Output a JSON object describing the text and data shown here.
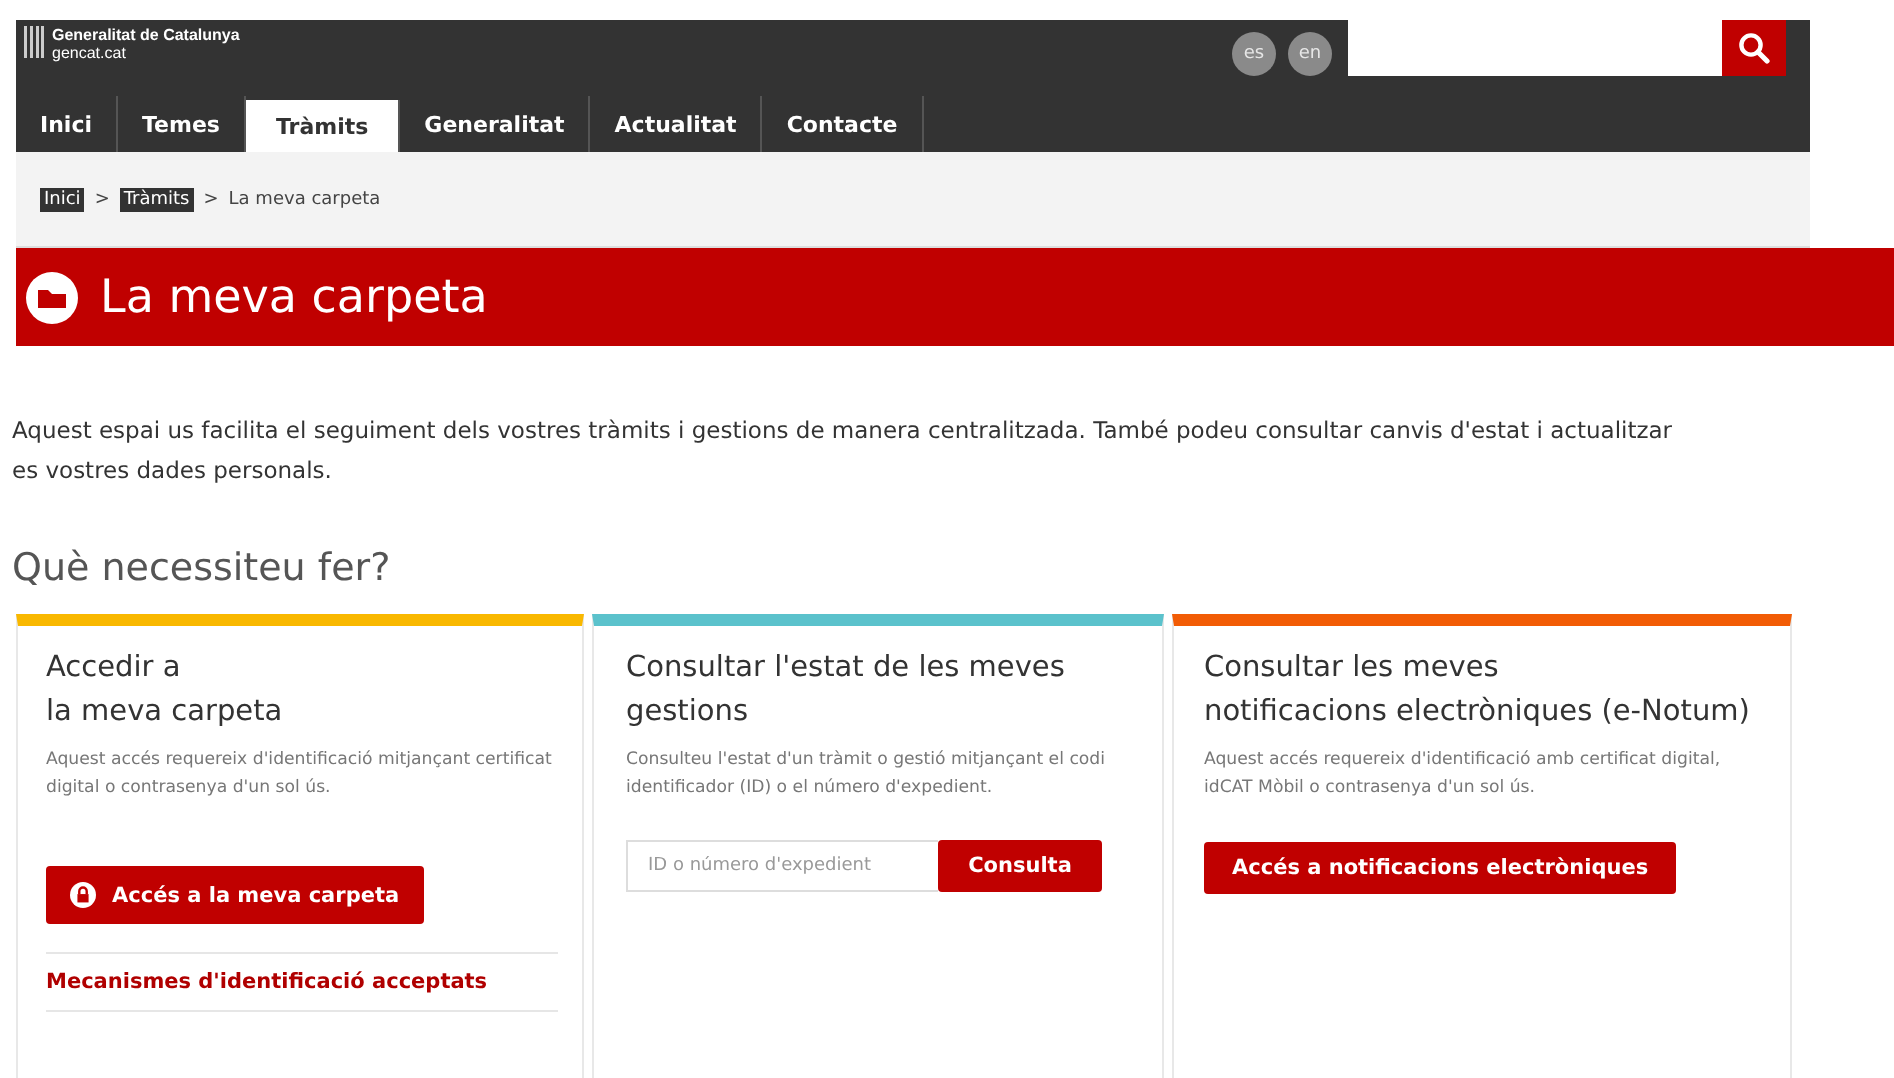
{
  "brand": {
    "title": "Generalitat de Catalunya",
    "subtitle": "gencat.cat"
  },
  "languages": [
    "es",
    "en"
  ],
  "nav": [
    {
      "label": "Inici",
      "selected": false
    },
    {
      "label": "Temes",
      "selected": false
    },
    {
      "label": "Tràmits",
      "selected": true
    },
    {
      "label": "Generalitat",
      "selected": false
    },
    {
      "label": "Actualitat",
      "selected": false
    },
    {
      "label": "Contacte",
      "selected": false
    }
  ],
  "breadcrumb": {
    "links": [
      "Inici",
      "Tràmits"
    ],
    "current": "La meva carpeta",
    "separator": ">"
  },
  "banner": {
    "title": "La meva carpeta"
  },
  "intro": [
    "Aquest espai us facilita el seguiment dels vostres tràmits i gestions de manera centralitzada. També podeu consultar canvis d'estat i actualitzar",
    "es vostres dades personals."
  ],
  "section_title": "Què necessiteu fer?",
  "cards": [
    {
      "color": "#f9b800",
      "title": [
        "Accedir a",
        "la meva carpeta"
      ],
      "description": "Aquest accés requereix d'identificació mitjançant certificat digital o contrasenya d'un sol ús.",
      "kind": "button",
      "button": {
        "label": "Accés a la meva carpeta",
        "icon": true
      },
      "link": "Mecanismes d'identificació acceptats"
    },
    {
      "color": "#5bc2cc",
      "title": [
        "Consultar l'estat de les meves",
        "gestions"
      ],
      "description": "Consulteu l'estat d'un tràmit o gestió mitjançant el codi identificador (ID) o el número d'expedient.",
      "kind": "search",
      "field": {
        "placeholder": "ID o número d'expedient"
      },
      "button": {
        "label": "Consulta"
      }
    },
    {
      "color": "#f25c05",
      "title": [
        "Consultar les meves",
        "notificacions electròniques (e-Notum)"
      ],
      "description": "Aquest accés requereix d'identificació amb certificat digital, idCAT Mòbil o contrasenya d'un sol ús.",
      "kind": "button",
      "button": {
        "label": "Accés a notificacions electròniques"
      }
    }
  ]
}
